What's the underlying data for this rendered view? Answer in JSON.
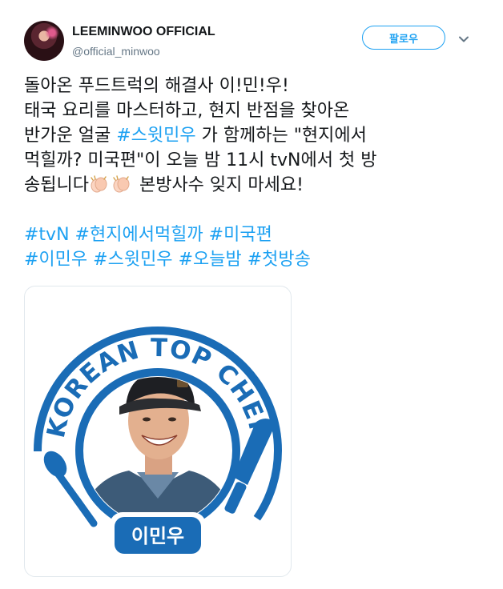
{
  "header": {
    "display_name": "LEEMINWOO OFFICIAL",
    "handle": "@official_minwoo",
    "follow_label": "팔로우"
  },
  "tweet": {
    "line1": "돌아온 푸드트럭의 해결사 이!민!우!",
    "line2": "태국 요리를 마스터하고, 현지 반점을 찾아온",
    "line3_pre": "반가운 얼굴 ",
    "line3_tag": "#스윗민우",
    "line3_post": " 가 함께하는 \"현지에서",
    "line4": "먹힐까? 미국편\"이 오늘 밤 11시 tvN에서 첫 방",
    "line5_pre": "송됩니다",
    "line5_post": " 본방사수 잊지 마세요!",
    "hashtags_line1": [
      "#tvN",
      "#현지에서먹힐까",
      "#미국편"
    ],
    "hashtags_line2": [
      "#이민우",
      "#스윗민우",
      "#오늘밤",
      "#첫방송"
    ]
  },
  "media": {
    "badge_arc_text": "KOREAN TOP CHEF",
    "name_plate": "이민우"
  },
  "colors": {
    "accent": "#1da1f2",
    "logo_blue": "#1a6cb6",
    "text": "#14171a",
    "muted": "#657786"
  },
  "icons": {
    "caret": "chevron-down-icon",
    "clap": "clapping-hands-icon"
  }
}
